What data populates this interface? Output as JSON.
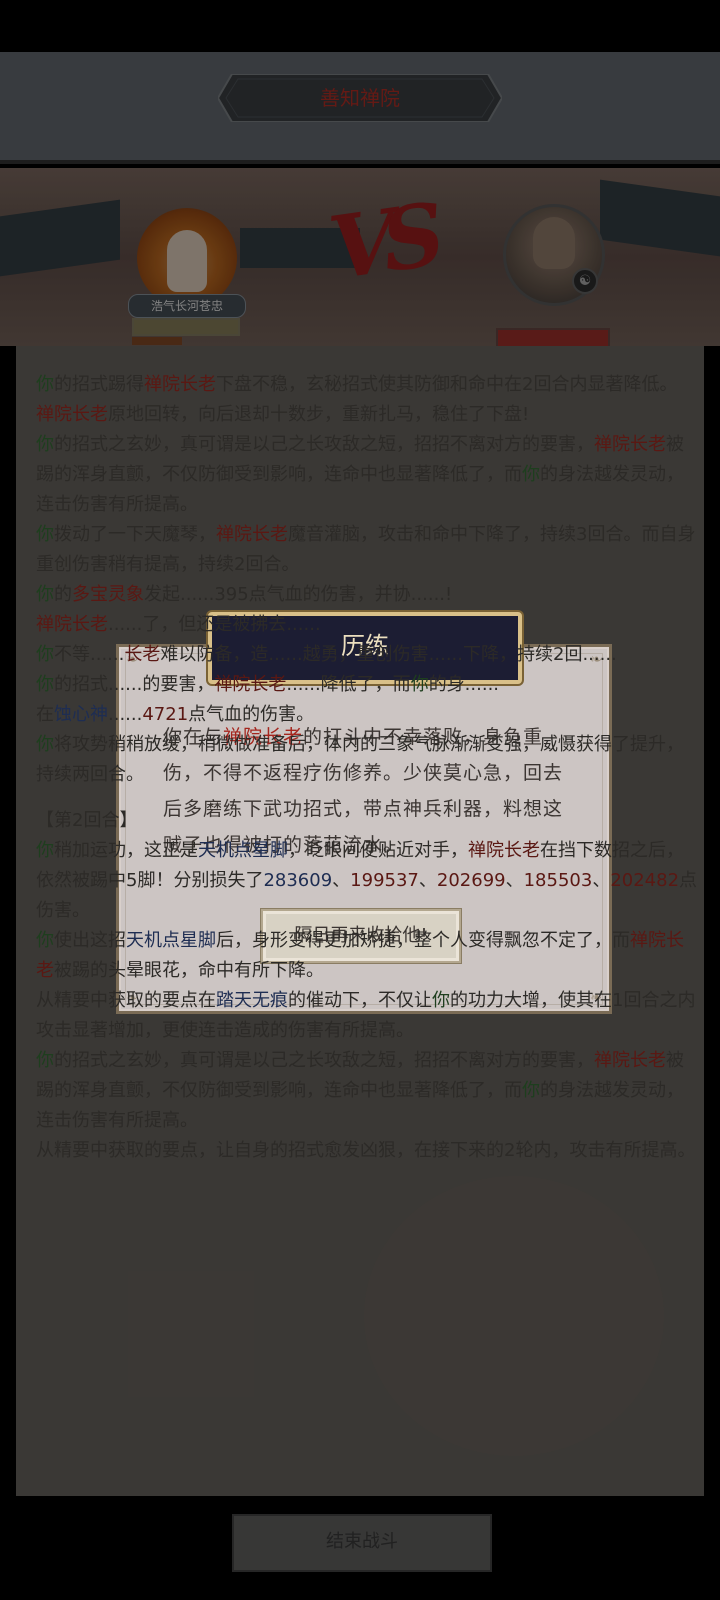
{
  "header": {
    "location_title": "善知禅院"
  },
  "battle": {
    "player_name": "浩气长河苍忠",
    "vs_label": "VS",
    "player_hp_fraction": 1.0,
    "enemy_hp_fraction": 1.0
  },
  "log": [
    [
      [
        "g",
        "你"
      ],
      [
        "",
        "的招式踢得"
      ],
      [
        "r",
        "禅院长老"
      ],
      [
        "",
        "下盘不稳，玄秘招式使其防御和命中在2回合内显著降低。"
      ]
    ],
    [
      [
        "r",
        "禅院长老"
      ],
      [
        "",
        "原地回转，向后退却十数步，重新扎马，稳住了下盘!"
      ]
    ],
    [
      [
        "g",
        "你"
      ],
      [
        "",
        "的招式之玄妙，真可谓是以己之长攻敌之短，招招不离对方的要害，"
      ],
      [
        "r",
        "禅院长老"
      ],
      [
        "",
        "被踢的浑身直颤，不仅防御受到影响，连命中也显著降低了，而"
      ],
      [
        "g",
        "你"
      ],
      [
        "",
        "的身法越发灵动，连击伤害有所提高。"
      ]
    ],
    [
      [
        "g",
        "你"
      ],
      [
        "",
        "拨动了一下天魔琴，"
      ],
      [
        "r",
        "禅院长老"
      ],
      [
        "",
        "魔音灌脑，攻击和命中下降了，持续3回合。而自身重创伤害稍有提高，持续2回合。"
      ]
    ],
    [
      [
        "g",
        "你"
      ],
      [
        "",
        "的"
      ],
      [
        "r",
        "多宝灵象"
      ],
      [
        "",
        "发起......395点气血的伤害，并协......!"
      ]
    ],
    [
      [
        "r",
        "禅院长老"
      ],
      [
        "",
        "......了，但还是被拂去......"
      ]
    ],
    [
      [
        "g",
        "你"
      ],
      [
        "",
        "不等......"
      ],
      [
        "r",
        "长老"
      ],
      [
        "",
        "难以防备，造......越勇，重创伤害......下降，持续2回......"
      ]
    ],
    [
      [
        "g",
        "你"
      ],
      [
        "",
        "的招式......的要害，"
      ],
      [
        "r",
        "禅院长老"
      ],
      [
        "",
        "......降低了，而"
      ],
      [
        "g",
        "你"
      ],
      [
        "",
        "的身......"
      ]
    ],
    [
      [
        "",
        "在"
      ],
      [
        "b",
        "蚀心神"
      ],
      [
        "",
        "......"
      ],
      [
        "r",
        "4721"
      ],
      [
        "",
        "点气血的伤害。"
      ]
    ],
    [
      [
        "g",
        "你"
      ],
      [
        "",
        "将攻势稍稍放缓，稍微做准备后，体内的三象气脉渐渐变强，威慑获得了提升，持续两回合。"
      ]
    ],
    [
      [
        "",
        "【第2回合】"
      ]
    ],
    [
      [
        "g",
        "你"
      ],
      [
        "",
        "稍加运功，这正是"
      ],
      [
        "b",
        "天机点星脚"
      ],
      [
        "",
        "，眨眼间便贴近对手，"
      ],
      [
        "r",
        "禅院长老"
      ],
      [
        "",
        "在挡下数招之后，依然被踢中5脚！分别损失了"
      ],
      [
        "b",
        "283609"
      ],
      [
        "",
        "、"
      ],
      [
        "r",
        "199537"
      ],
      [
        "",
        "、"
      ],
      [
        "r",
        "202699"
      ],
      [
        "",
        "、"
      ],
      [
        "r",
        "185503"
      ],
      [
        "",
        "、"
      ],
      [
        "r",
        "202482"
      ],
      [
        "",
        "点伤害。"
      ]
    ],
    [
      [
        "g",
        "你"
      ],
      [
        "",
        "使出这招"
      ],
      [
        "b",
        "天机点星脚"
      ],
      [
        "",
        "后，身形变得更加矫捷，整个人变得飘忽不定了，而"
      ],
      [
        "r",
        "禅院长老"
      ],
      [
        "",
        "被踢的头晕眼花，命中有所下降。"
      ]
    ],
    [
      [
        "",
        "从精要中获取的要点在"
      ],
      [
        "b",
        "踏天无痕"
      ],
      [
        "",
        "的催动下，不仅让"
      ],
      [
        "g",
        "你"
      ],
      [
        "",
        "的功力大增，使其在1回合之内攻击显著增加，更使连击造成的伤害有所提高。"
      ]
    ],
    [
      [
        "g",
        "你"
      ],
      [
        "",
        "的招式之玄妙，真可谓是以己之长攻敌之短，招招不离对方的要害，"
      ],
      [
        "r",
        "禅院长老"
      ],
      [
        "",
        "被踢的浑身直颤，不仅防御受到影响，连命中也显著降低了，而"
      ],
      [
        "g",
        "你"
      ],
      [
        "",
        "的身法越发灵动，连击伤害有所提高。"
      ]
    ],
    [
      [
        "",
        "从精要中获取的要点，让自身的招式愈发凶狠，在接下来的2轮内，攻击有所提高。"
      ]
    ]
  ],
  "end_button_label": "结束战斗",
  "modal": {
    "title": "历练",
    "body_before": "你在与",
    "body_enemy": "禅院长老",
    "body_after": "的打斗中不幸落败，身负重伤，不得不返程疗伤修养。少侠莫心急，回去后多磨练下武功招式，带点神兵利器，料想这贼子也得被打的落花流水。",
    "button_label": "隔日再来收拾他!"
  },
  "icons": [
    "yin-yang-icon"
  ]
}
